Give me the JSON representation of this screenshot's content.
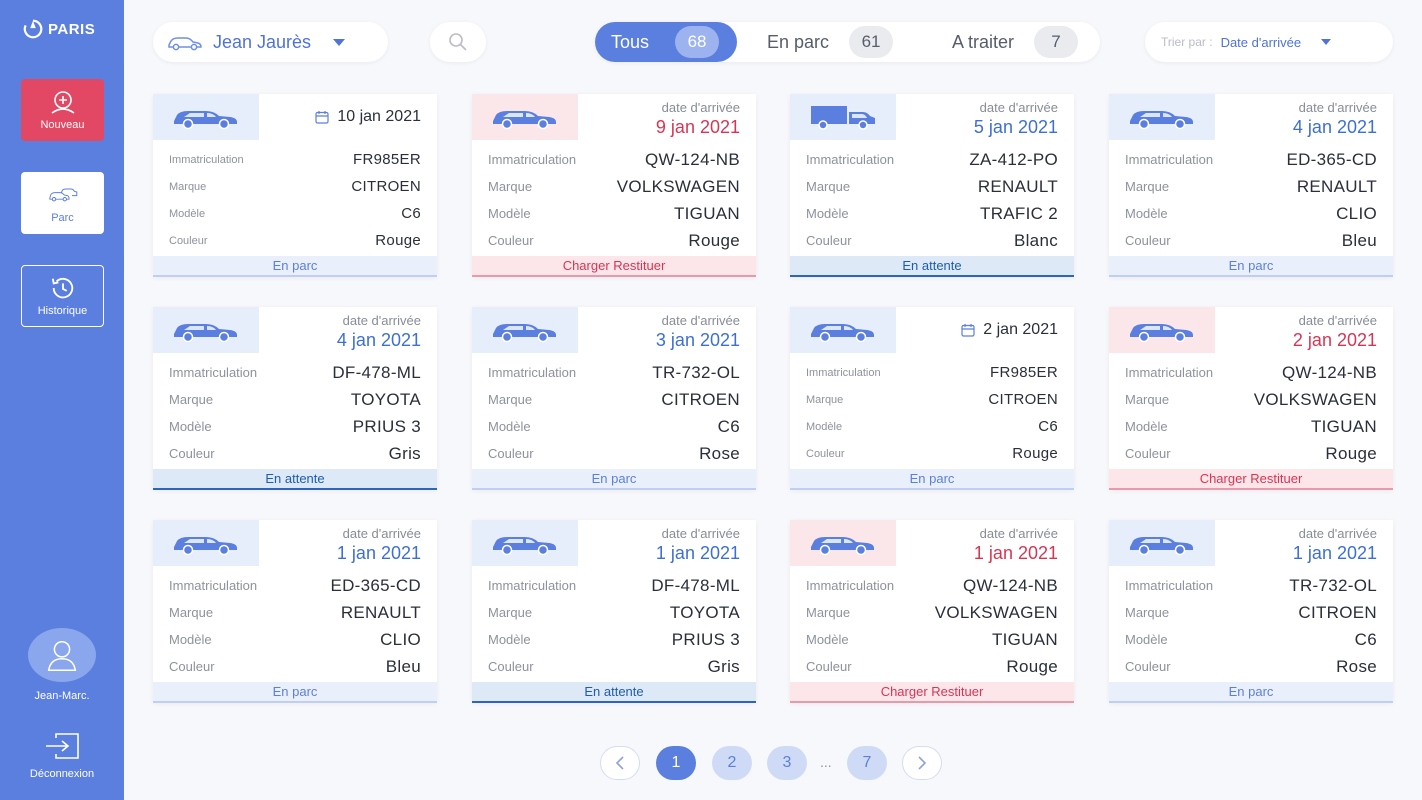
{
  "sidebar": {
    "logo_text": "PARIS",
    "new_label": "Nouveau",
    "parc_label": "Parc",
    "history_label": "Historique",
    "user_name": "Jean-Marc.",
    "logout_label": "Déconnexion"
  },
  "topbar": {
    "location": "Jean Jaurès",
    "filters": [
      {
        "label": "Tous",
        "count": "68"
      },
      {
        "label": "En parc",
        "count": "61"
      },
      {
        "label": "A traiter",
        "count": "7"
      }
    ],
    "sort_label": "Trier par :",
    "sort_value": "Date d'arrivée"
  },
  "labels": {
    "date_label": "date d'arrivée",
    "plate": "Immatriculation",
    "brand": "Marque",
    "model": "Modèle",
    "color": "Couleur"
  },
  "cards": [
    {
      "date": "10 jan 2021",
      "plate": "FR985ER",
      "brand": "CITROEN",
      "model": "C6",
      "color": "Rouge",
      "status": "En parc"
    },
    {
      "date": "9 jan 2021",
      "plate": "QW-124-NB",
      "brand": "VOLKSWAGEN",
      "model": "TIGUAN",
      "color": "Rouge",
      "status": "Charger Restituer"
    },
    {
      "date": "5 jan 2021",
      "plate": "ZA-412-PO",
      "brand": "RENAULT",
      "model": "TRAFIC 2",
      "color": "Blanc",
      "status": "En attente"
    },
    {
      "date": "4 jan 2021",
      "plate": "ED-365-CD",
      "brand": "RENAULT",
      "model": "CLIO",
      "color": "Bleu",
      "status": "En parc"
    },
    {
      "date": "4 jan 2021",
      "plate": "DF-478-ML",
      "brand": "TOYOTA",
      "model": "PRIUS 3",
      "color": "Gris",
      "status": "En attente"
    },
    {
      "date": "3 jan 2021",
      "plate": "TR-732-OL",
      "brand": "CITROEN",
      "model": "C6",
      "color": "Rose",
      "status": "En parc"
    },
    {
      "date": "2 jan 2021",
      "plate": "FR985ER",
      "brand": "CITROEN",
      "model": "C6",
      "color": "Rouge",
      "status": "En parc"
    },
    {
      "date": "2 jan 2021",
      "plate": "QW-124-NB",
      "brand": "VOLKSWAGEN",
      "model": "TIGUAN",
      "color": "Rouge",
      "status": "Charger Restituer"
    },
    {
      "date": "1 jan 2021",
      "plate": "ED-365-CD",
      "brand": "RENAULT",
      "model": "CLIO",
      "color": "Bleu",
      "status": "En parc"
    },
    {
      "date": "1 jan 2021",
      "plate": "DF-478-ML",
      "brand": "TOYOTA",
      "model": "PRIUS 3",
      "color": "Gris",
      "status": "En attente"
    },
    {
      "date": "1 jan 2021",
      "plate": "QW-124-NB",
      "brand": "VOLKSWAGEN",
      "model": "TIGUAN",
      "color": "Rouge",
      "status": "Charger Restituer"
    },
    {
      "date": "1 jan 2021",
      "plate": "TR-732-OL",
      "brand": "CITROEN",
      "model": "C6",
      "color": "Rose",
      "status": "En parc"
    }
  ],
  "pagination": {
    "pages": [
      "1",
      "2",
      "3",
      "7"
    ],
    "ellipsis": "..."
  }
}
